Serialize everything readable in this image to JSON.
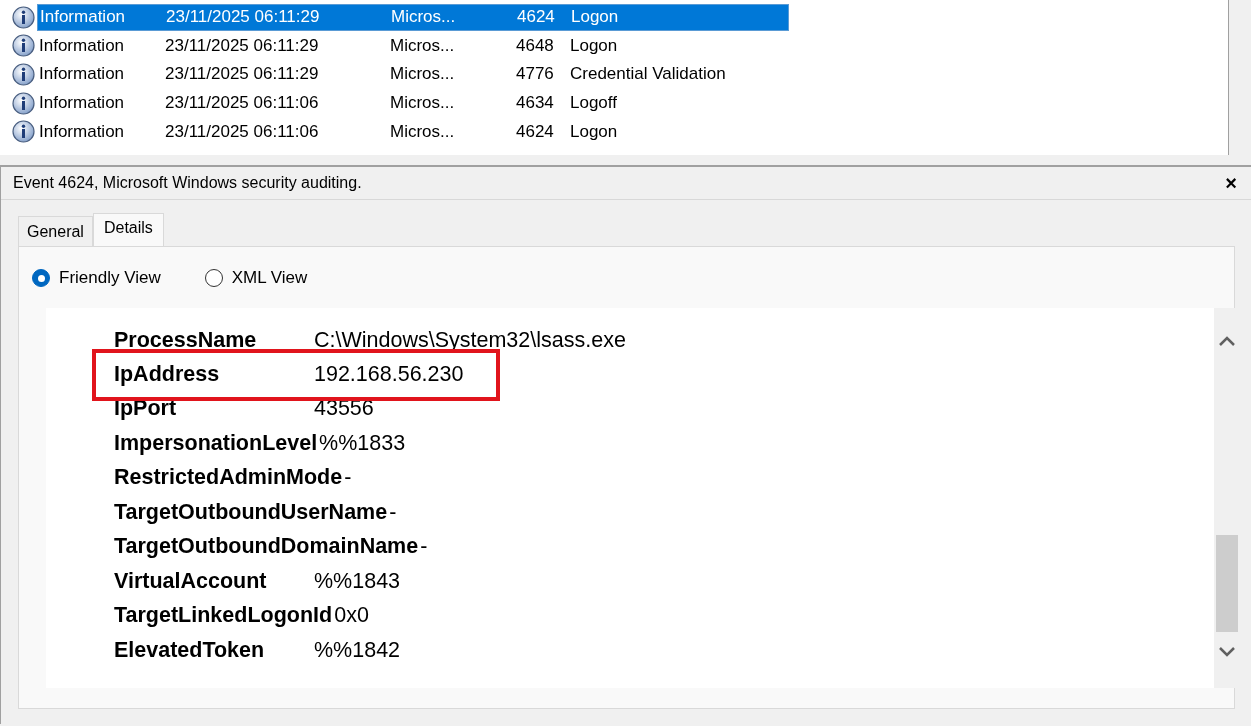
{
  "events": [
    {
      "level": "Information",
      "date": "23/11/2025 06:11:29",
      "source": "Micros...",
      "event_id": "4624",
      "category": "Logon",
      "selected": true
    },
    {
      "level": "Information",
      "date": "23/11/2025 06:11:29",
      "source": "Micros...",
      "event_id": "4648",
      "category": "Logon",
      "selected": false
    },
    {
      "level": "Information",
      "date": "23/11/2025 06:11:29",
      "source": "Micros...",
      "event_id": "4776",
      "category": "Credential Validation",
      "selected": false
    },
    {
      "level": "Information",
      "date": "23/11/2025 06:11:06",
      "source": "Micros...",
      "event_id": "4634",
      "category": "Logoff",
      "selected": false
    },
    {
      "level": "Information",
      "date": "23/11/2025 06:11:06",
      "source": "Micros...",
      "event_id": "4624",
      "category": "Logon",
      "selected": false
    }
  ],
  "details_pane": {
    "title": "Event 4624, Microsoft Windows security auditing.",
    "close": "×",
    "tabs": [
      {
        "label": "General",
        "selected": false
      },
      {
        "label": "Details",
        "selected": true
      }
    ],
    "views": [
      {
        "label": "Friendly View",
        "selected": true
      },
      {
        "label": "XML View",
        "selected": false
      }
    ],
    "fields": [
      {
        "name": "ProcessName",
        "value": "C:\\Windows\\System32\\lsass.exe",
        "highlighted": false
      },
      {
        "name": "IpAddress",
        "value": "192.168.56.230",
        "highlighted": true
      },
      {
        "name": "IpPort",
        "value": "43556",
        "highlighted": false
      },
      {
        "name": "ImpersonationLevel",
        "value": "%%1833",
        "highlighted": false
      },
      {
        "name": "RestrictedAdminMode",
        "value": "-",
        "highlighted": false
      },
      {
        "name": "TargetOutboundUserName",
        "value": "-",
        "highlighted": false
      },
      {
        "name": "TargetOutboundDomainName",
        "value": "-",
        "highlighted": false
      },
      {
        "name": "VirtualAccount",
        "value": "%%1843",
        "highlighted": false
      },
      {
        "name": "TargetLinkedLogonId",
        "value": "0x0",
        "highlighted": false
      },
      {
        "name": "ElevatedToken",
        "value": "%%1842",
        "highlighted": false
      }
    ]
  }
}
